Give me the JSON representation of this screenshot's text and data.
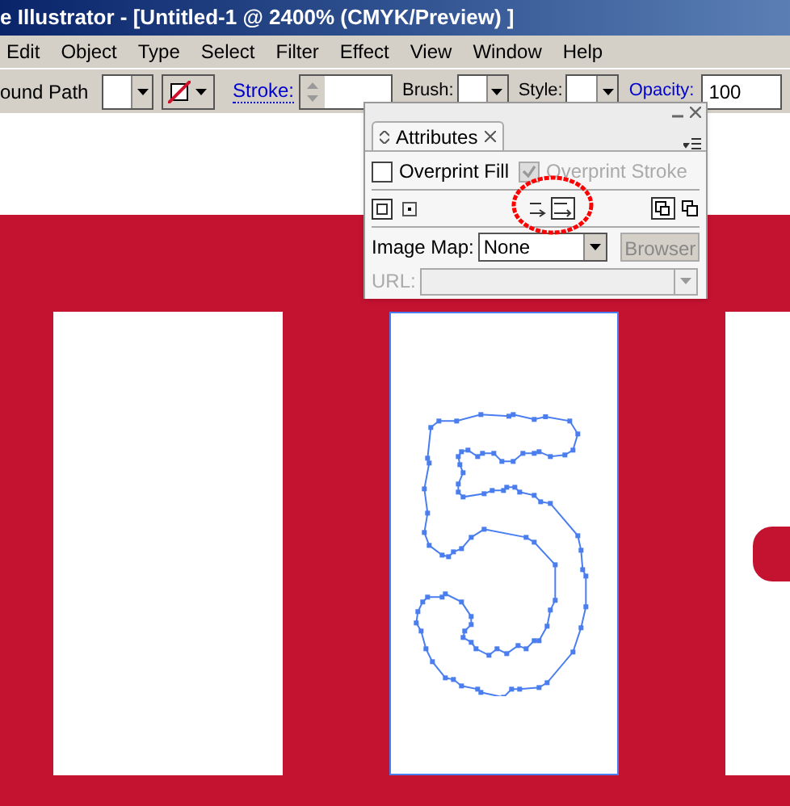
{
  "window": {
    "title": "e Illustrator - [Untitled-1 @ 2400% (CMYK/Preview) ]"
  },
  "menu": [
    "Edit",
    "Object",
    "Type",
    "Select",
    "Filter",
    "Effect",
    "View",
    "Window",
    "Help"
  ],
  "control_bar": {
    "path_label": "ound Path",
    "stroke_label": "Stroke:",
    "brush_label": "Brush:",
    "style_label": "Style:",
    "opacity_label": "Opacity:",
    "opacity_value": "100"
  },
  "attributes_panel": {
    "tab": "Attributes",
    "checkboxes": [
      {
        "label": "Overprint Fill",
        "checked": false,
        "disabled": false
      },
      {
        "label": "Overprint Stroke",
        "checked": true,
        "disabled": true
      }
    ],
    "image_map": {
      "label": "Image Map:",
      "value": "None"
    },
    "browser_button": {
      "label": "Browser",
      "disabled": true
    },
    "url": {
      "label": "URL:",
      "disabled": true
    }
  }
}
